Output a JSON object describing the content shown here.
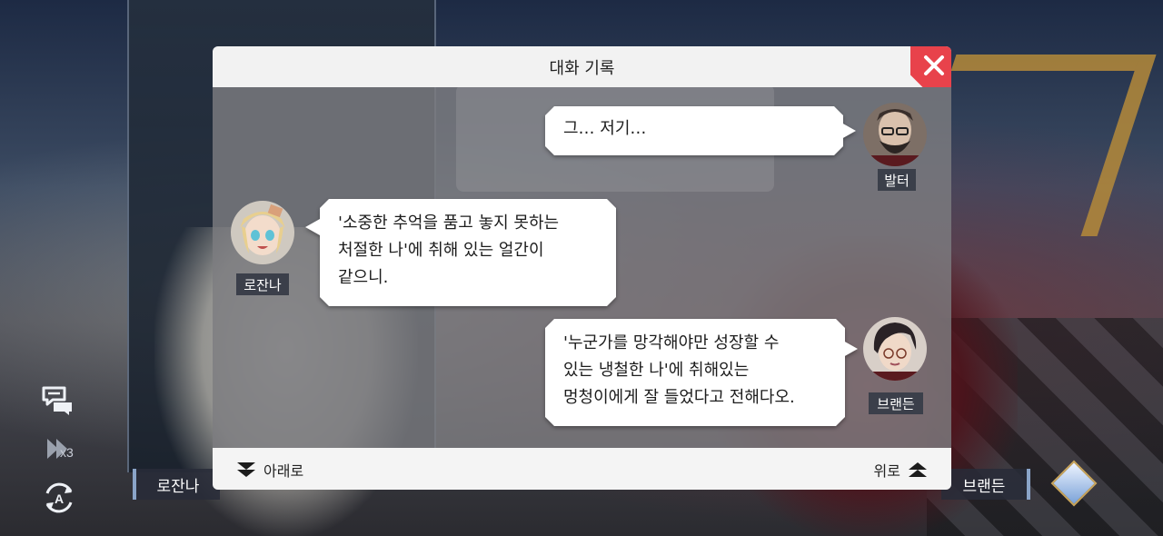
{
  "modal": {
    "title": "대화 기록",
    "close_icon": "close-icon",
    "footer": {
      "down_label": "아래로",
      "up_label": "위로"
    }
  },
  "messages": [
    {
      "speaker": "발터",
      "side": "right",
      "lines": [
        "그… 저기…"
      ]
    },
    {
      "speaker": "로잔나",
      "side": "left",
      "lines": [
        "'소중한 추억을 품고 놓지 못하는",
        "처절한 나'에 취해 있는 얼간이",
        "같으니."
      ]
    },
    {
      "speaker": "브랜든",
      "side": "right",
      "lines": [
        "'누군가를 망각해야만 성장할 수",
        "있는 냉철한 나'에 취해있는",
        "멍청이에게 잘 들었다고 전해다오."
      ]
    }
  ],
  "hud": {
    "log_icon": "chat-log-icon",
    "fast_forward_icon": "fast-forward-icon",
    "fast_forward_label": "x3",
    "auto_icon": "auto-play-icon",
    "left_name": "로잔나",
    "right_name": "브랜든"
  },
  "colors": {
    "close_red": "#e8424b",
    "header_bg": "#f2f2f2",
    "name_tag_bg": "#3b3f4a"
  }
}
